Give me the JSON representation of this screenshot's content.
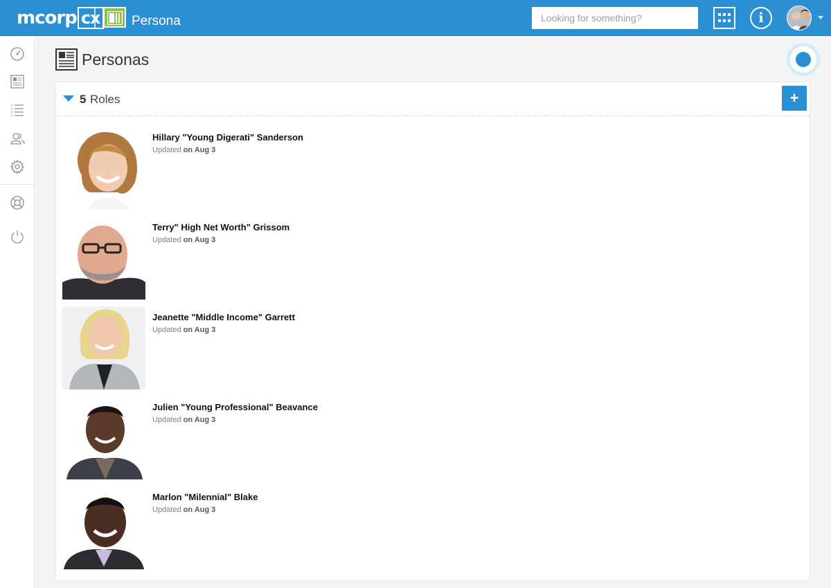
{
  "header": {
    "logo_text": "mcorp",
    "logo_box": "cx",
    "app_title": "Persona",
    "search_placeholder": "Looking for something?"
  },
  "page": {
    "title": "Personas"
  },
  "roles": {
    "count": "5",
    "label": "Roles"
  },
  "personas": [
    {
      "name": "Hillary \"Young Digerati\" Sanderson",
      "updated_prefix": "Updated",
      "updated_date": "on Aug 3"
    },
    {
      "name": "Terry\" High Net Worth\" Grissom",
      "updated_prefix": "Updated",
      "updated_date": "on Aug 3"
    },
    {
      "name": "Jeanette \"Middle Income\" Garrett",
      "updated_prefix": "Updated",
      "updated_date": "on Aug 3"
    },
    {
      "name": "Julien \"Young Professional\" Beavance",
      "updated_prefix": "Updated",
      "updated_date": "on Aug 3"
    },
    {
      "name": "Marlon \"Milennial\" Blake",
      "updated_prefix": "Updated",
      "updated_date": "on Aug 3"
    }
  ],
  "colors": {
    "primary": "#2b8fd3",
    "app_icon": "#8bc34a"
  },
  "icons": [
    "grid-icon",
    "info-icon",
    "dashboard-icon",
    "document-icon",
    "list-icon",
    "users-icon",
    "gear-icon",
    "help-icon",
    "power-icon",
    "plus-icon"
  ]
}
